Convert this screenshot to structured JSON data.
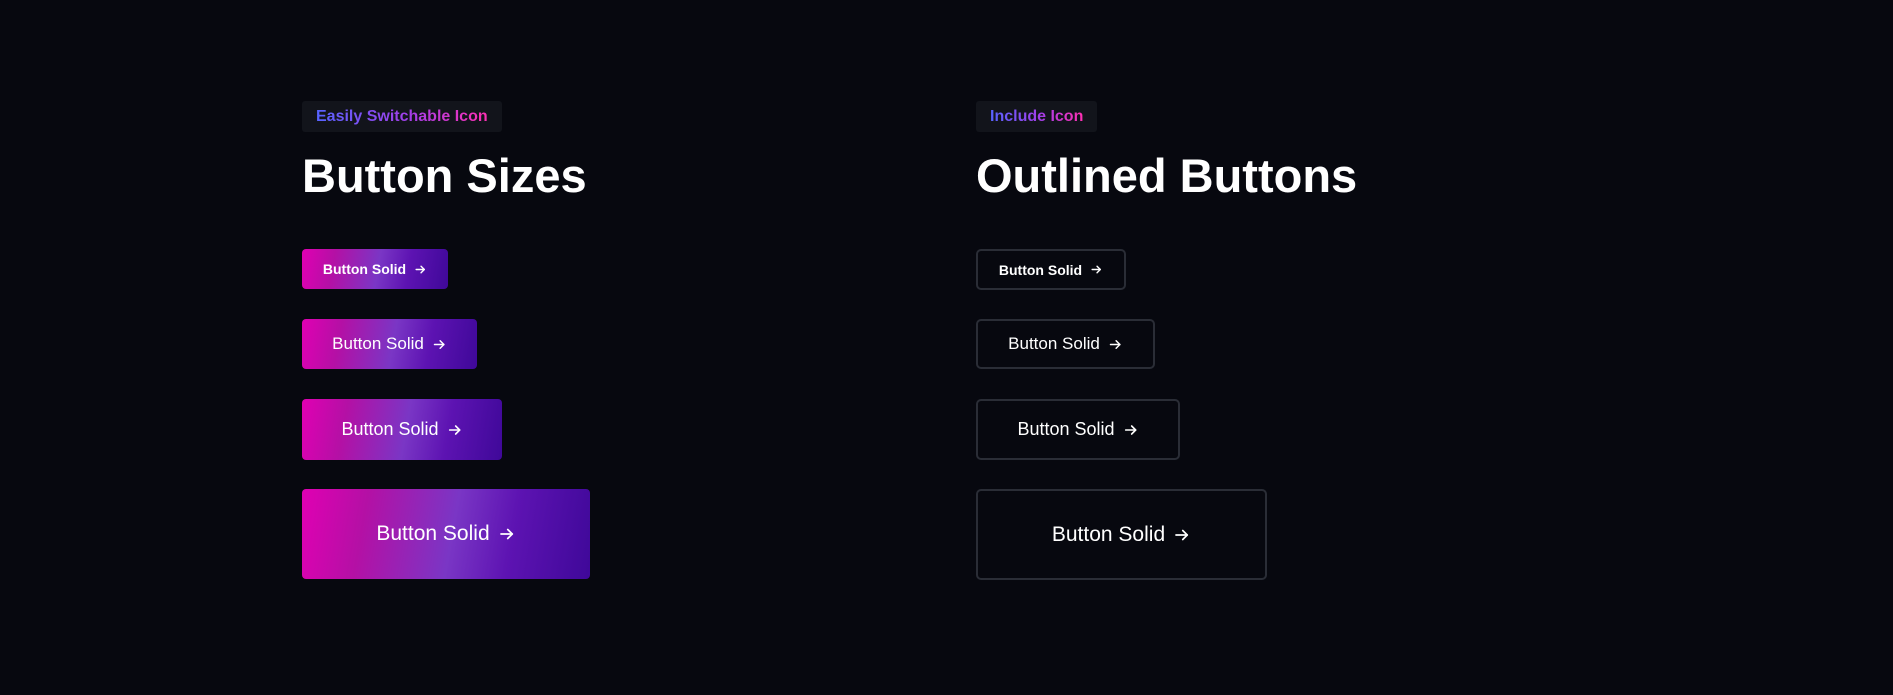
{
  "left_section": {
    "tag": "Easily Switchable Icon",
    "title": "Button Sizes",
    "buttons": [
      {
        "label": "Button Solid",
        "icon": "arrow-right-icon"
      },
      {
        "label": "Button Solid",
        "icon": "arrow-right-icon"
      },
      {
        "label": "Button Solid",
        "icon": "arrow-right-icon"
      },
      {
        "label": "Button Solid",
        "icon": "arrow-right-icon"
      }
    ]
  },
  "right_section": {
    "tag": "Include Icon",
    "title": "Outlined Buttons",
    "buttons": [
      {
        "label": "Button Solid",
        "icon": "arrow-right-icon"
      },
      {
        "label": "Button Solid",
        "icon": "arrow-right-icon"
      },
      {
        "label": "Button Solid",
        "icon": "arrow-right-icon"
      },
      {
        "label": "Button Solid",
        "icon": "arrow-right-icon"
      }
    ]
  },
  "colors": {
    "background": "#07080f",
    "tag_background": "#12141b",
    "gradient_start": "#e000b3",
    "gradient_mid": "#7a36c5",
    "gradient_end": "#3f0899",
    "outline_border": "#2a2d36",
    "text": "#ffffff"
  }
}
